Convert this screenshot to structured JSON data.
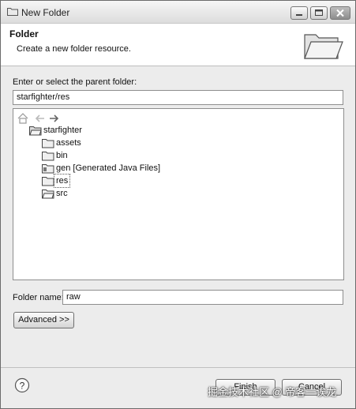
{
  "window": {
    "title": "New Folder"
  },
  "banner": {
    "title": "Folder",
    "description": "Create a new folder resource."
  },
  "parent": {
    "label": "Enter or select the parent folder:",
    "value": "starfighter/res"
  },
  "tree": {
    "items": [
      {
        "label": "starfighter",
        "icon": "project-icon",
        "selected": false
      },
      {
        "label": "assets",
        "icon": "folder-icon",
        "selected": false
      },
      {
        "label": "bin",
        "icon": "folder-icon",
        "selected": false
      },
      {
        "label": "gen [Generated Java Files]",
        "icon": "source-folder-icon",
        "selected": false
      },
      {
        "label": "res",
        "icon": "folder-icon",
        "selected": true
      },
      {
        "label": "src",
        "icon": "source-folder-icon",
        "selected": false
      }
    ]
  },
  "folder_name": {
    "label": "Folder name:",
    "value": "raw"
  },
  "buttons": {
    "advanced": "Advanced >>",
    "finish": "Finish",
    "cancel": "Cancel"
  },
  "watermark": "掘金技术社区 @ 帝客一诶龙"
}
